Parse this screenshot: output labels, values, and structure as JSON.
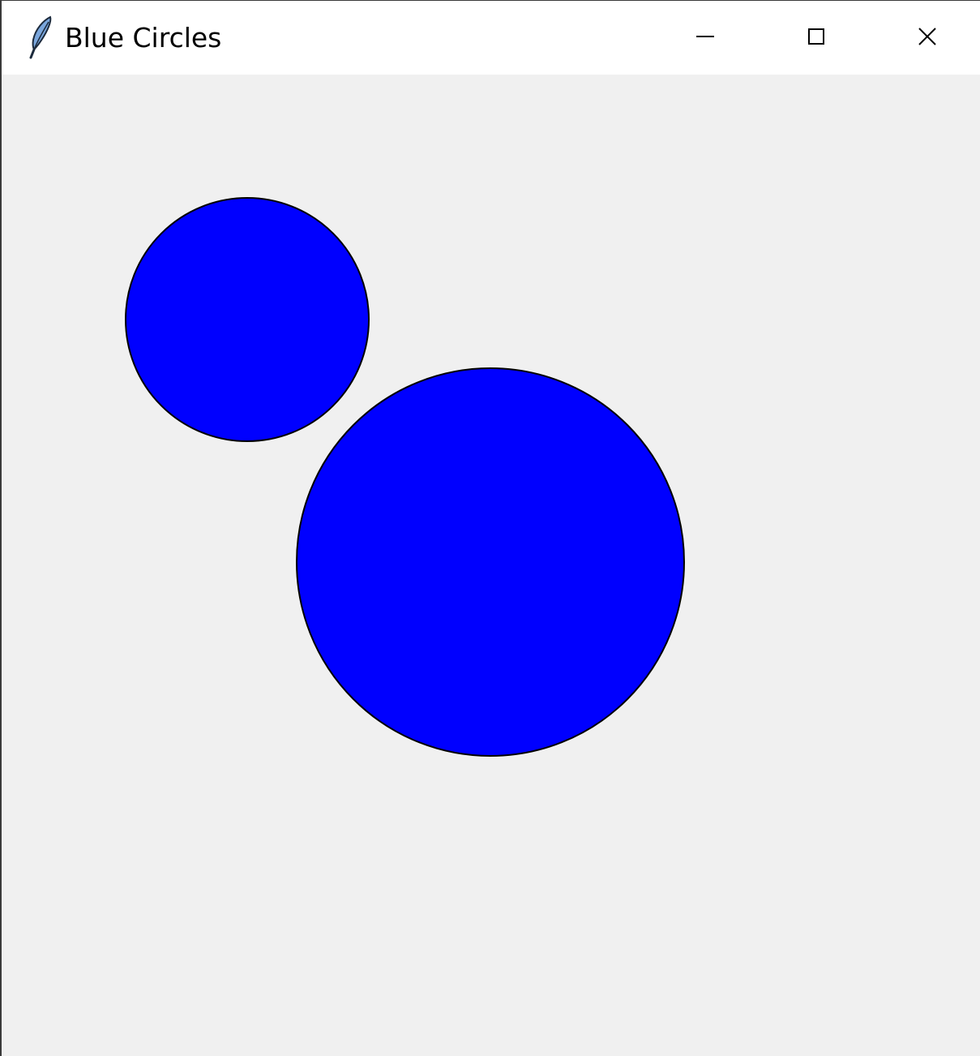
{
  "window": {
    "title": "Blue Circles",
    "app_icon": "feather-icon",
    "controls": [
      {
        "name": "minimize-button",
        "icon": "minimize-icon"
      },
      {
        "name": "maximize-button",
        "icon": "maximize-icon"
      },
      {
        "name": "close-button",
        "icon": "close-icon"
      }
    ]
  },
  "canvas": {
    "background_color": "#f0f0f0",
    "shapes": [
      {
        "type": "circle",
        "fill": "#0000ff",
        "outline": "#000000"
      },
      {
        "type": "circle",
        "fill": "#0000ff",
        "outline": "#000000"
      }
    ]
  }
}
